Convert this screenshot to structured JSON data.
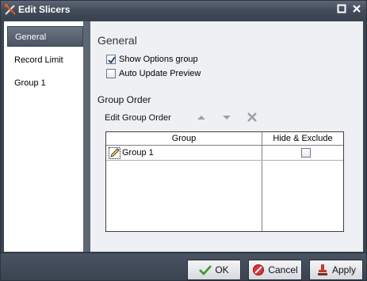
{
  "window": {
    "title": "Edit Slicers"
  },
  "sidebar": {
    "items": [
      {
        "label": "General",
        "active": true
      },
      {
        "label": "Record Limit",
        "active": false
      },
      {
        "label": "Group 1",
        "active": false
      }
    ]
  },
  "general": {
    "section_title": "General",
    "show_options_group": {
      "label": "Show Options group",
      "checked": true
    },
    "auto_update_preview": {
      "label": "Auto Update Preview",
      "checked": false
    }
  },
  "group_order": {
    "title": "Group Order",
    "edit_label": "Edit Group Order",
    "icons": [
      "move-up-icon",
      "move-down-icon",
      "delete-icon"
    ],
    "table": {
      "columns": [
        "Group",
        "Hide & Exclude"
      ],
      "rows": [
        {
          "group": "Group 1",
          "hide_exclude": false
        }
      ]
    }
  },
  "footer": {
    "ok_label": "OK",
    "cancel_label": "Cancel",
    "apply_label": "Apply"
  }
}
